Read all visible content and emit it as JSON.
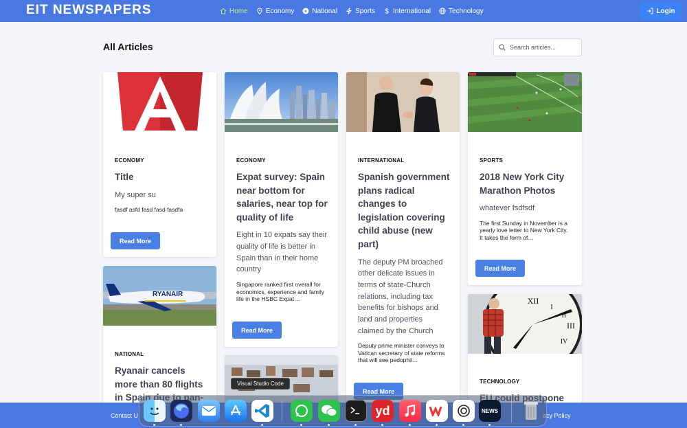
{
  "brand": "EIT NEWSPAPERS",
  "nav": [
    {
      "label": "Home",
      "icon": "home-icon",
      "active": true
    },
    {
      "label": "Economy",
      "icon": "location-icon"
    },
    {
      "label": "National",
      "icon": "badge-icon"
    },
    {
      "label": "Sports",
      "icon": "bolt-icon"
    },
    {
      "label": "International",
      "icon": "dollar-icon"
    },
    {
      "label": "Technology",
      "icon": "globe-icon"
    }
  ],
  "login_label": "Login",
  "page_title": "All Articles",
  "search": {
    "placeholder": "Search articles..."
  },
  "read_more_label": "Read More",
  "articles": [
    {
      "category": "ECONOMY",
      "title": "Title",
      "subtitle": "My super su",
      "excerpt": "fasdf asfd fasd fasd fasdfa",
      "image": "angular-logo"
    },
    {
      "category": "ECONOMY",
      "title": "Expat survey: Spain near bottom for salaries, near top for quality of life",
      "subtitle": "Eight in 10 expats say their quality of life is better in Spain than in their home country",
      "excerpt": "Singapore ranked first overall for economics, experience and family life in the HSBC Expat…",
      "image": "singapore-skyline"
    },
    {
      "category": "INTERNATIONAL",
      "title": "Spanish government plans radical changes to legislation covering child abuse (new part)",
      "subtitle": "The deputy PM broached other delicate issues in terms of state-Church relations, including tax benefits for bishops and land and properties claimed by the Church",
      "excerpt": "Deputy prime minister conveys to Vatican secretary of state reforms that will see pedophil…",
      "image": "handshake-photo"
    },
    {
      "category": "SPORTS",
      "title": "2018 New York City Marathon Photos",
      "subtitle": "whatever fsdfsdf",
      "excerpt": "The first Sunday in November is a yearly love letter to New York City. It takes the form of…",
      "image": "football-pitch"
    },
    {
      "category": "NATIONAL",
      "title": "Ryanair cancels more than 80 flights in Spain due to pan-",
      "image": "ryanair-plane"
    },
    {
      "category": "",
      "title": "",
      "image": "snowy-town"
    },
    {
      "category": "TECHNOLOGY",
      "title": "EU could postpone",
      "image": "clock-worker"
    }
  ],
  "footer": {
    "contact": "Contact U",
    "privacy": "acy Policy"
  },
  "dock": {
    "tooltip": "Visual Studio Code",
    "apps": [
      "Finder",
      "Firefox",
      "Mail",
      "App Store",
      "Visual Studio Code",
      "WhatsApp",
      "WeChat",
      "Terminal",
      "Youdao Dictionary",
      "Music",
      "WPS Office",
      "ChatGPT",
      "News",
      "Trash"
    ],
    "yd_label": "yd",
    "news_label": "NEWS"
  }
}
